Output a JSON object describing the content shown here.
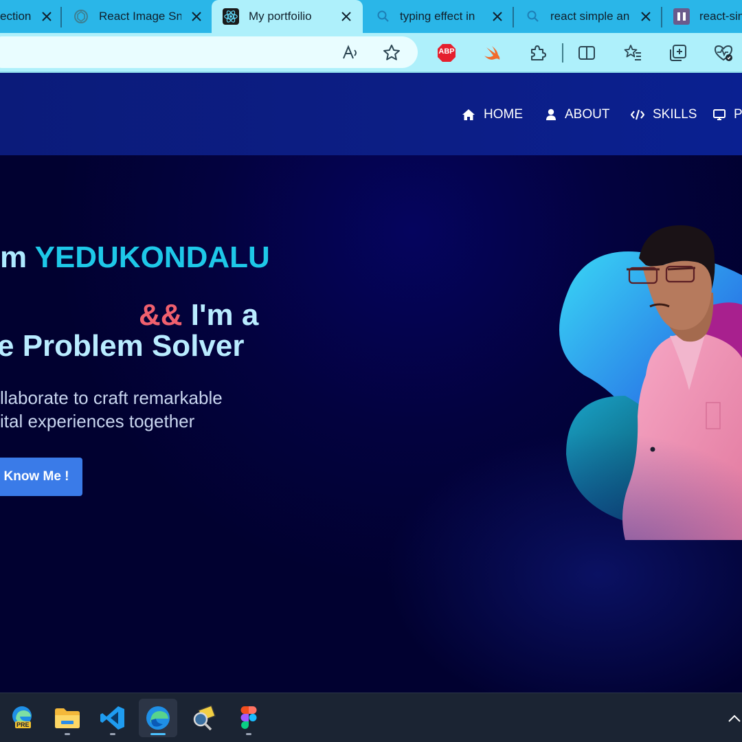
{
  "browser": {
    "tabs": [
      {
        "title": "ection",
        "favicon": "page-icon"
      },
      {
        "title": "React Image Sn",
        "favicon": "chatgpt-icon"
      },
      {
        "title": "My portfoilio",
        "favicon": "react-icon",
        "active": true
      },
      {
        "title": "typing effect in",
        "favicon": "search-icon"
      },
      {
        "title": "react simple an",
        "favicon": "search-icon"
      },
      {
        "title": "react-sin",
        "favicon": "site-icon"
      }
    ],
    "address_value": "",
    "toolbar_icons": [
      "read-aloud-icon",
      "favorite-star-icon",
      "adblock-plus-icon",
      "swift-extension-icon",
      "extensions-icon",
      "split-screen-icon",
      "favorites-icon",
      "collections-icon",
      "browser-essentials-icon"
    ],
    "abp_label": "ABP",
    "colors": {
      "tabbar": "#2ab6e8",
      "active_tab": "#aef0fb"
    }
  },
  "site": {
    "nav": [
      {
        "label": "HOME",
        "icon": "home-icon"
      },
      {
        "label": "ABOUT",
        "icon": "user-icon"
      },
      {
        "label": "SKILLS",
        "icon": "code-icon"
      },
      {
        "label": "P",
        "icon": "monitor-icon"
      }
    ],
    "hero": {
      "greeting": "m ",
      "name": "YEDUKONDALU",
      "amp": "&&",
      "im_a": " I'm a",
      "role": "e Problem Solver",
      "description_line1": "llaborate to craft remarkable",
      "description_line2": "ital experiences together",
      "cta_label": "Know Me !"
    },
    "colors": {
      "name": "#1ec8e8",
      "amp": "#f0606e",
      "cta": "#3a7be8",
      "nav_bg": "#0c1e86"
    }
  },
  "taskbar": {
    "apps": [
      {
        "name": "edge-preview",
        "icon": "edge-pre-icon",
        "badge": "PRE"
      },
      {
        "name": "file-explorer",
        "icon": "folder-icon"
      },
      {
        "name": "vscode",
        "icon": "vscode-icon"
      },
      {
        "name": "edge",
        "icon": "edge-icon",
        "active": true
      },
      {
        "name": "tool",
        "icon": "magnifier-app-icon"
      },
      {
        "name": "figma",
        "icon": "figma-icon"
      }
    ]
  }
}
